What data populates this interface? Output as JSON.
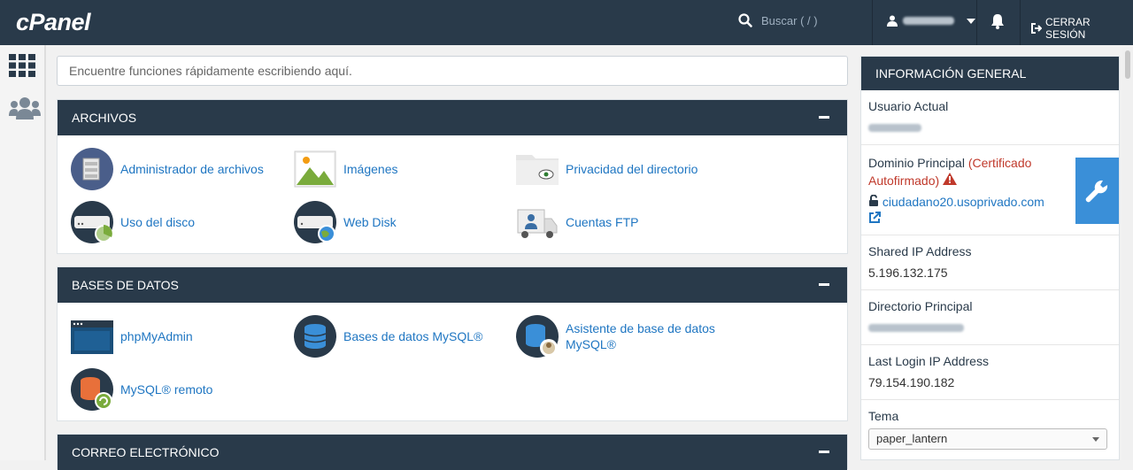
{
  "header": {
    "logo": "cPanel",
    "search_placeholder": "Buscar ( / )",
    "logout_label": "CERRAR SESIÓN"
  },
  "quick_search": {
    "placeholder": "Encuentre funciones rápidamente escribiendo aquí."
  },
  "panels": {
    "archivos": {
      "title": "ARCHIVOS",
      "items": [
        "Administrador de archivos",
        "Imágenes",
        "Privacidad del directorio",
        "Uso del disco",
        "Web Disk",
        "Cuentas FTP"
      ]
    },
    "bases": {
      "title": "BASES DE DATOS",
      "items": [
        "phpMyAdmin",
        "Bases de datos MySQL®",
        "Asistente de base de datos",
        "MySQL®",
        "MySQL® remoto"
      ]
    },
    "correo": {
      "title": "CORREO ELECTRÓNICO"
    }
  },
  "general_info": {
    "title": "INFORMACIÓN GENERAL",
    "current_user_label": "Usuario Actual",
    "domain_label": "Dominio Principal",
    "domain_warning_1": "(Certificado",
    "domain_warning_2": "Autofirmado)",
    "domain_value": "ciudadano20.usoprivado.com",
    "shared_ip_label": "Shared IP Address",
    "shared_ip_value": "5.196.132.175",
    "home_dir_label": "Directorio Principal",
    "last_login_label": "Last Login IP Address",
    "last_login_value": "79.154.190.182",
    "theme_label": "Tema",
    "theme_value": "paper_lantern"
  },
  "colors": {
    "header": "#293a4a",
    "link": "#1f76c2",
    "warning": "#c0392b",
    "accent": "#3a8fd8"
  }
}
